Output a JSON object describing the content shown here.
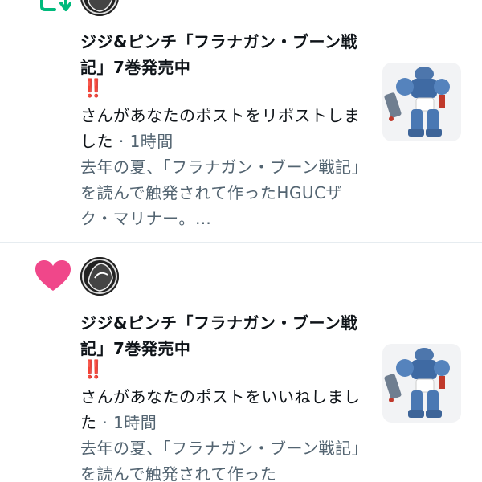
{
  "notifications": [
    {
      "type": "retweet",
      "type_icon": "retweet-icon",
      "author": "ジジ&ピンチ「フラナガン・ブーン戦記」7巻発売中",
      "emoji": "‼️",
      "action": "さんがあなたのポストをリポストしました",
      "time": " · 1時間",
      "preview": "去年の夏、「フラナガン・ブーン戦記」を読んで触発されて作ったHGUCザク・マリナー。…",
      "thumbnail": "gundam-model-thumbnail",
      "accent": "#00ba7c"
    },
    {
      "type": "like",
      "type_icon": "heart-icon",
      "author": "ジジ&ピンチ「フラナガン・ブーン戦記」7巻発売中",
      "emoji": "‼️",
      "action": "さんがあなたのポストをいいねしました",
      "time": " · 1時間",
      "preview": "去年の夏、「フラナガン・ブーン戦記」を読んで触発されて作った",
      "thumbnail": "gundam-model-thumbnail",
      "accent": "#f91880"
    }
  ]
}
